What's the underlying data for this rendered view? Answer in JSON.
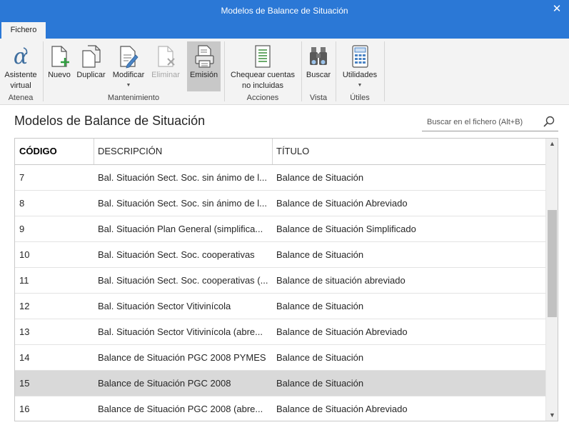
{
  "window": {
    "title": "Modelos de Balance de Situación",
    "close_glyph": "✕"
  },
  "tabs": [
    {
      "label": "Fichero",
      "selected": true
    }
  ],
  "ribbon": {
    "groups": [
      {
        "label": "Atenea",
        "buttons": [
          {
            "label": "Asistente virtual",
            "line1": "Asistente",
            "line2": "virtual",
            "icon": "alpha-icon"
          }
        ]
      },
      {
        "label": "Mantenimiento",
        "buttons": [
          {
            "label": "Nuevo",
            "icon": "new-document-icon"
          },
          {
            "label": "Duplicar",
            "icon": "duplicate-icon"
          },
          {
            "label": "Modificar",
            "icon": "edit-document-icon",
            "dropdown": true
          },
          {
            "label": "Eliminar",
            "icon": "delete-document-icon",
            "disabled": true
          },
          {
            "label": "Emisión",
            "icon": "print-icon",
            "active": true
          }
        ]
      },
      {
        "label": "Acciones",
        "buttons": [
          {
            "label": "Chequear cuentas no incluidas",
            "line1": "Chequear cuentas",
            "line2": "no incluidas",
            "icon": "checklist-icon"
          }
        ]
      },
      {
        "label": "Vista",
        "buttons": [
          {
            "label": "Buscar",
            "icon": "binoculars-icon"
          }
        ]
      },
      {
        "label": "Útiles",
        "buttons": [
          {
            "label": "Utilidades",
            "icon": "calculator-icon",
            "dropdown": true
          }
        ]
      }
    ]
  },
  "page": {
    "title": "Modelos de Balance de Situación",
    "search_placeholder": "Buscar en el fichero (Alt+B)"
  },
  "table": {
    "columns": [
      "CÓDIGO",
      "DESCRIPCIÓN",
      "TÍTULO"
    ],
    "rows": [
      {
        "codigo": "7",
        "descripcion": "Bal. Situación Sect. Soc. sin ánimo de l...",
        "titulo": "Balance de Situación"
      },
      {
        "codigo": "8",
        "descripcion": "Bal. Situación Sect. Soc. sin ánimo de l...",
        "titulo": "Balance de Situación Abreviado"
      },
      {
        "codigo": "9",
        "descripcion": "Bal. Situación Plan General (simplifica...",
        "titulo": "Balance de Situación Simplificado"
      },
      {
        "codigo": "10",
        "descripcion": "Bal. Situación Sect. Soc. cooperativas",
        "titulo": "Balance de Situación"
      },
      {
        "codigo": "11",
        "descripcion": "Bal. Situación Sect. Soc. cooperativas (...",
        "titulo": "Balance de situación abreviado"
      },
      {
        "codigo": "12",
        "descripcion": "Bal. Situación Sector Vitivinícola",
        "titulo": "Balance de Situación"
      },
      {
        "codigo": "13",
        "descripcion": "Bal. Situación Sector Vitivinícola (abre...",
        "titulo": "Balance de Situación Abreviado"
      },
      {
        "codigo": "14",
        "descripcion": "Balance de Situación PGC 2008 PYMES",
        "titulo": "Balance de Situación"
      },
      {
        "codigo": "15",
        "descripcion": "Balance de Situación PGC 2008",
        "titulo": "Balance de Situación",
        "selected": true
      },
      {
        "codigo": "16",
        "descripcion": "Balance de Situación PGC 2008 (abre...",
        "titulo": "Balance de Situación Abreviado"
      }
    ]
  },
  "colors": {
    "accent": "#2b78d6",
    "ribbon_bg": "#f3f3f3",
    "selected_row": "#d9d9d9",
    "new_plus": "#2e9e3e",
    "delete_x": "#a6a6a6"
  }
}
